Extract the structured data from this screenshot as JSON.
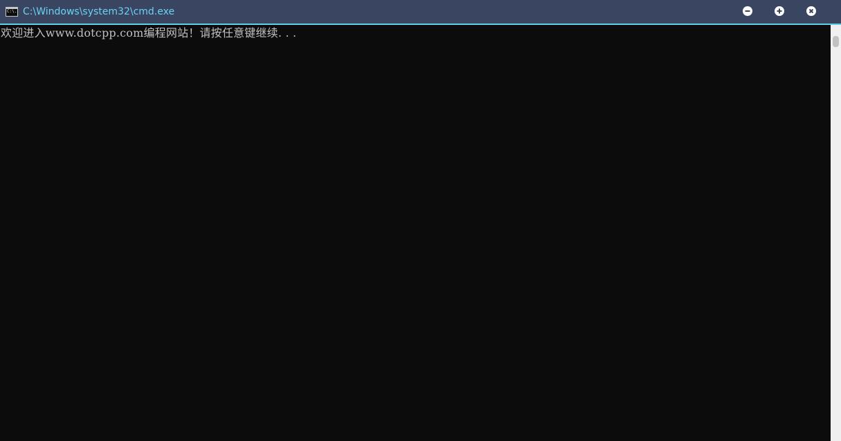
{
  "window": {
    "title": "C:\\Windows\\system32\\cmd.exe",
    "icon": "cmd-console-icon",
    "icon_text": "C:\\.",
    "controls": {
      "minimize_icon": "minus-circle-icon",
      "maximize_icon": "plus-circle-icon",
      "close_icon": "x-circle-icon"
    },
    "colors": {
      "titlebar": "#3a4562",
      "title_text": "#6ad3f0",
      "accent_border": "#5fd0e8",
      "console_bg": "#0c0c0c",
      "console_text": "#c0c0c0"
    }
  },
  "console": {
    "lines": [
      "欢迎进入www.dotcpp.com编程网站！请按任意键继续. . ."
    ]
  }
}
